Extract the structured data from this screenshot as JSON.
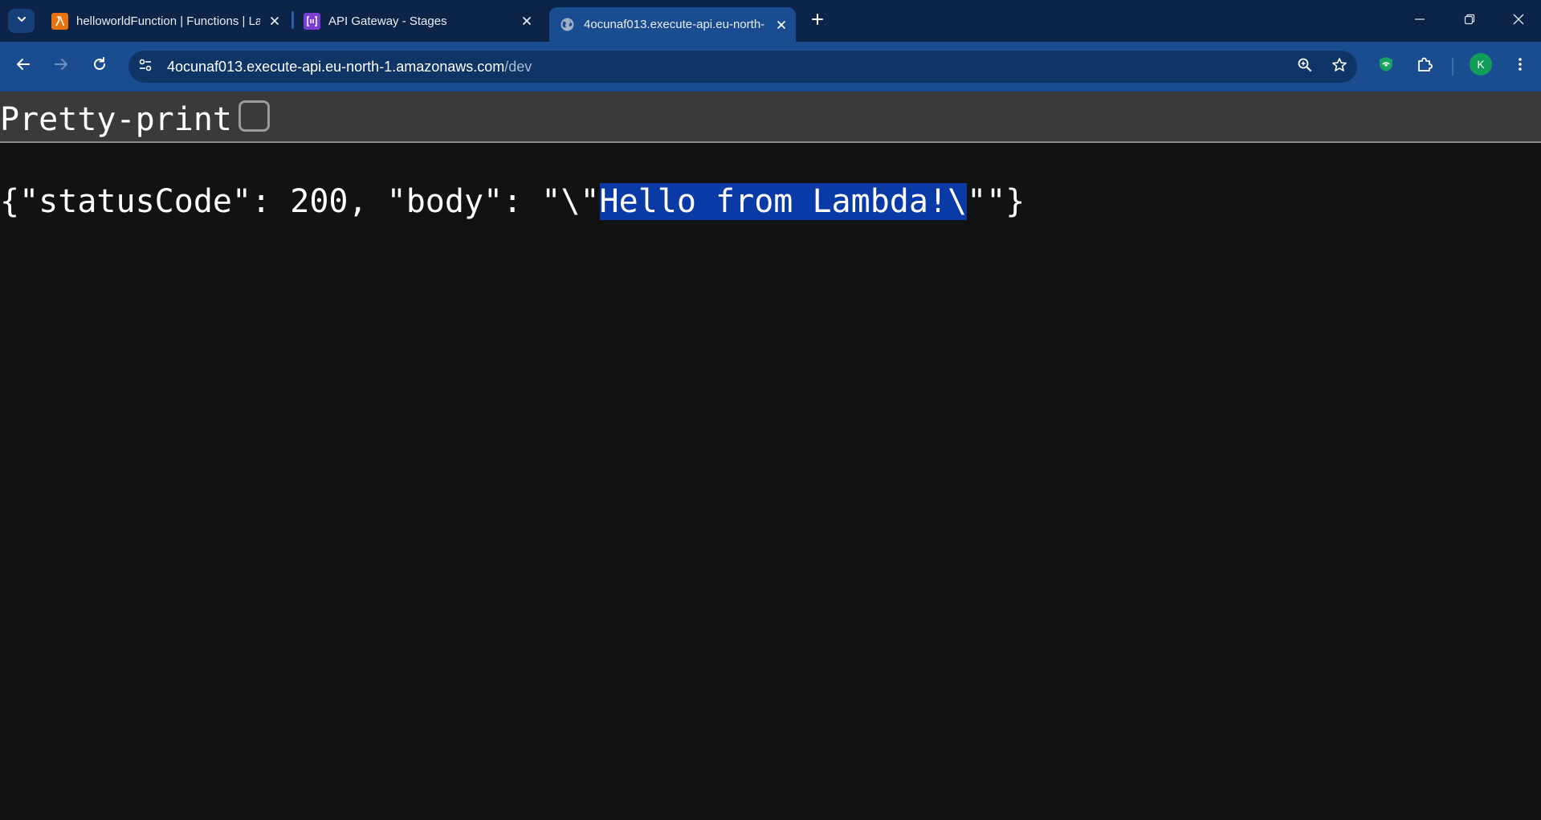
{
  "browser": {
    "tabs": [
      {
        "title": "helloworldFunction | Functions | La",
        "favicon": "aws-lambda-icon",
        "active": false
      },
      {
        "title": "API Gateway - Stages",
        "favicon": "api-gateway-icon",
        "active": false
      },
      {
        "title": "4ocunaf013.execute-api.eu-north-",
        "favicon": "globe-icon",
        "active": true
      }
    ],
    "address_bar": {
      "host": "4ocunaf013.execute-api.eu-north-1.amazonaws.com",
      "path": "/dev"
    },
    "profile_initial": "K",
    "colors": {
      "tabstrip": "#0b2447",
      "toolbar": "#1a4d8f",
      "omnibox": "#0e3566"
    }
  },
  "page": {
    "pretty_print_label": "Pretty-print",
    "pretty_print_checked": false,
    "json_prefix": "{\"statusCode\": 200, \"body\": \"\\\"",
    "json_selected": "Hello from Lambda!\\",
    "json_suffix": "\"\"}",
    "selection_color": "#0a3aa6",
    "background": "#121212"
  }
}
